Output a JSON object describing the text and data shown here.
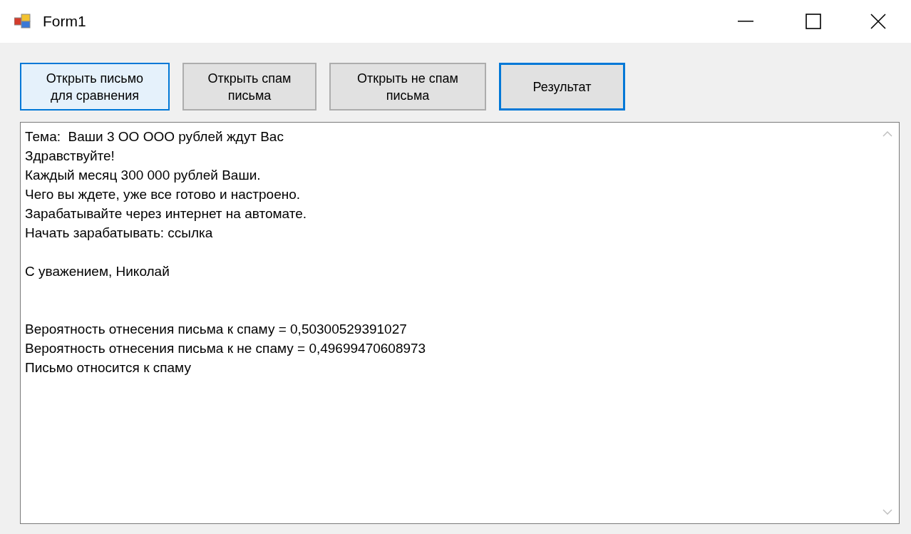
{
  "window": {
    "title": "Form1"
  },
  "buttons": [
    {
      "label": "Открыть письмо для сравнения",
      "hovered": true,
      "focused": false
    },
    {
      "label": "Открыть спам письма",
      "hovered": false,
      "focused": false
    },
    {
      "label": "Открыть не спам письма",
      "hovered": false,
      "focused": false
    },
    {
      "label": "Результат",
      "hovered": false,
      "focused": true
    }
  ],
  "text_box": {
    "paragraphs": [
      [
        "Тема:  Ваши 3 ОО ООО рублей ждут Вас",
        "Здравствуйте!",
        "Каждый месяц 300 000 рублей Ваши.",
        "Чего вы ждете, уже все готово и настроено.",
        "Зарабатывайте через интернет на автомате.",
        "Начать зарабатывать: ссылка"
      ],
      [
        "С уважением, Николай"
      ],
      [
        "Вероятность отнесения письма к спаму = 0,50300529391027",
        "Вероятность отнесения письма к не спаму = 0,49699470608973",
        "Письмо относится к спаму"
      ]
    ]
  }
}
